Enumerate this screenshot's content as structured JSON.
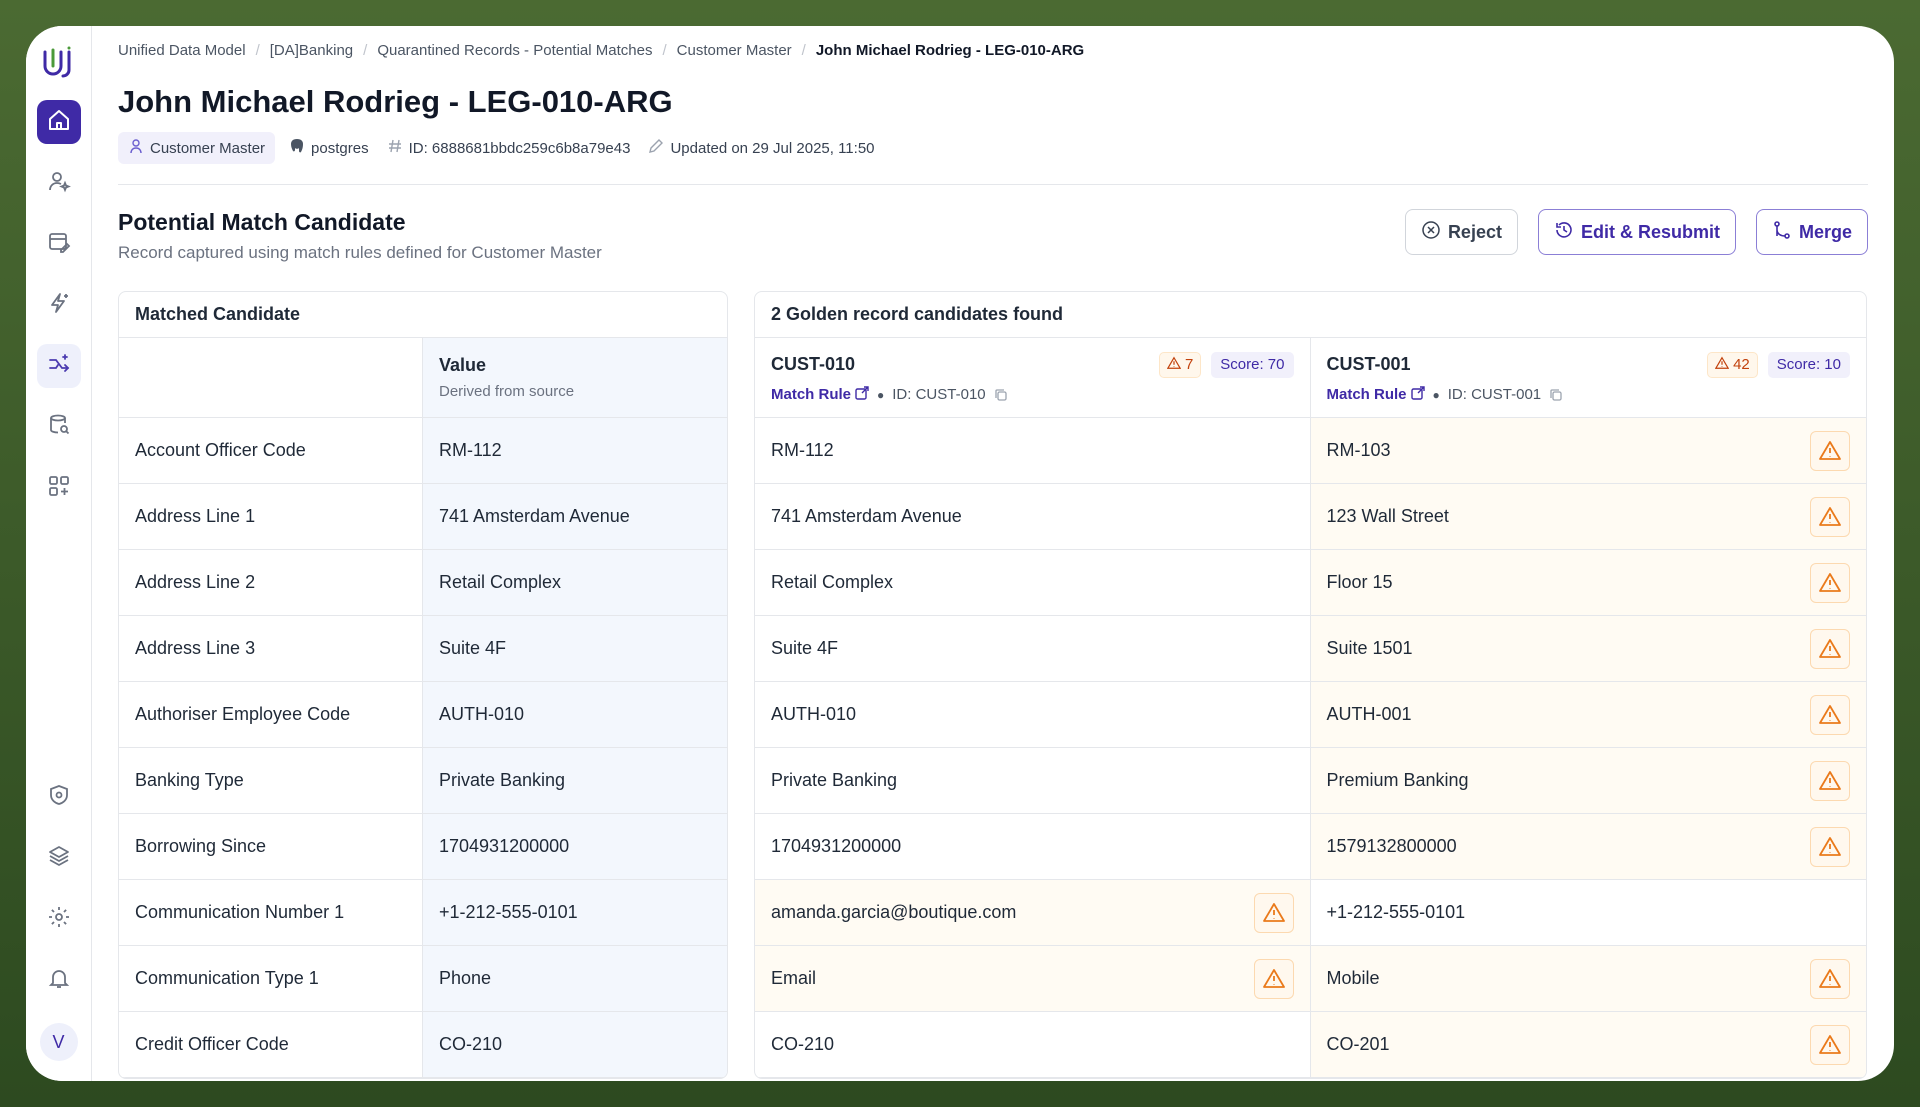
{
  "breadcrumb": [
    "Unified Data Model",
    "[DA]Banking",
    "Quarantined Records - Potential Matches",
    "Customer Master",
    "John Michael Rodrieg - LEG-010-ARG"
  ],
  "page": {
    "title": "John Michael Rodrieg - LEG-010-ARG",
    "entity": "Customer Master",
    "source": "postgres",
    "record_id": "ID: 6888681bbdc259c6b8a79e43",
    "updated": "Updated on 29 Jul 2025, 11:50"
  },
  "section": {
    "title": "Potential Match Candidate",
    "subtitle": "Record captured using match rules defined for Customer Master"
  },
  "actions": {
    "reject": "Reject",
    "edit": "Edit & Resubmit",
    "merge": "Merge"
  },
  "left_panel": {
    "title": "Matched Candidate",
    "value_header": "Value",
    "value_sub": "Derived from source"
  },
  "right_panel": {
    "title": "2 Golden record candidates found"
  },
  "candidates": [
    {
      "id": "CUST-010",
      "warnings": "7",
      "score": "Score: 70",
      "match_rule": "Match Rule",
      "record_id": "ID: CUST-010"
    },
    {
      "id": "CUST-001",
      "warnings": "42",
      "score": "Score: 10",
      "match_rule": "Match Rule",
      "record_id": "ID: CUST-001"
    }
  ],
  "rows": [
    {
      "label": "Account Officer Code",
      "value": "RM-112",
      "c1": "RM-112",
      "c2": "RM-103"
    },
    {
      "label": "Address Line 1",
      "value": "741 Amsterdam Avenue",
      "c1": "741 Amsterdam Avenue",
      "c2": "123 Wall Street"
    },
    {
      "label": "Address Line 2",
      "value": "Retail Complex",
      "c1": "Retail Complex",
      "c2": "Floor 15"
    },
    {
      "label": "Address Line 3",
      "value": "Suite 4F",
      "c1": "Suite 4F",
      "c2": "Suite 1501"
    },
    {
      "label": "Authoriser Employee Code",
      "value": "AUTH-010",
      "c1": "AUTH-010",
      "c2": "AUTH-001"
    },
    {
      "label": "Banking Type",
      "value": "Private Banking",
      "c1": "Private Banking",
      "c2": "Premium Banking"
    },
    {
      "label": "Borrowing Since",
      "value": "1704931200000",
      "c1": "1704931200000",
      "c2": "1579132800000"
    },
    {
      "label": "Communication Number 1",
      "value": "+1-212-555-0101",
      "c1": "amanda.garcia@boutique.com",
      "c2": "+1-212-555-0101"
    },
    {
      "label": "Communication Type 1",
      "value": "Phone",
      "c1": "Email",
      "c2": "Mobile"
    },
    {
      "label": "Credit Officer Code",
      "value": "CO-210",
      "c1": "CO-210",
      "c2": "CO-201"
    }
  ],
  "sidebar": {
    "avatar": "V"
  },
  "colors": {
    "accent": "#3f2aa6",
    "warning": "#ea7a1b",
    "warning_bg": "#fffbf3"
  }
}
